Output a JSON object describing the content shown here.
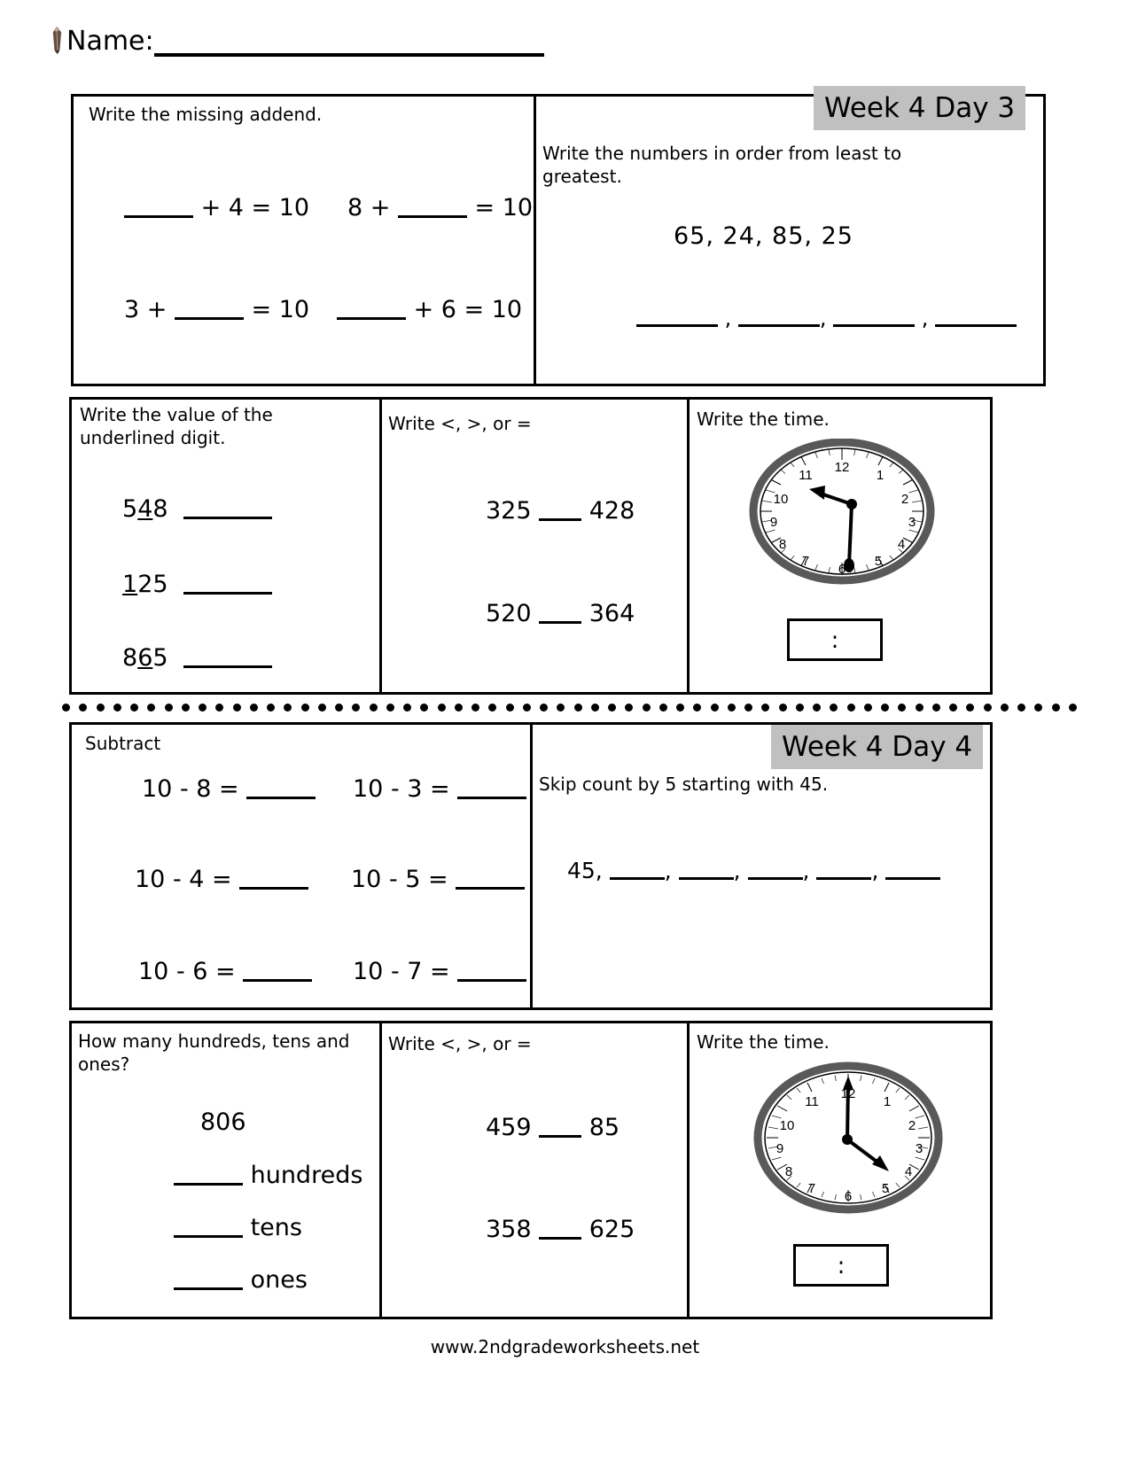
{
  "header": {
    "name_label": "Name:",
    "pencil_icon": "pencil-icon"
  },
  "banners": {
    "day3": "Week 4 Day 3",
    "day4": "Week 4 Day 4"
  },
  "sections": {
    "missing_addend": {
      "prompt": "Write the missing addend.",
      "problems": [
        {
          "text_before": "",
          "blank": true,
          "text_after": "+ 4 = 10"
        },
        {
          "text_before": "8 +",
          "blank": true,
          "text_after": "= 10"
        },
        {
          "text_before": "3 +",
          "blank": true,
          "text_after": "= 10"
        },
        {
          "text_before": "",
          "blank": true,
          "text_after": "+ 6 = 10"
        }
      ],
      "items": [
        "___ + 4 = 10",
        "8 + ___ = 10",
        "3 + ___ = 10",
        "___ + 6 = 10"
      ]
    },
    "order_numbers": {
      "prompt": "Write the numbers in order from least to greatest.",
      "numbers": "65,  24,  85,  25",
      "answer_blanks": 4
    },
    "place_value_underlined": {
      "prompt": "Write the value of the\nunderlined digit.",
      "problems": [
        {
          "pre": "5",
          "underlined": "4",
          "post": "8"
        },
        {
          "pre": "",
          "underlined": "1",
          "post": "25"
        },
        {
          "pre": "8",
          "underlined": "6",
          "post": "5"
        }
      ]
    },
    "compare_top": {
      "prompt": "Write <, >, or =",
      "problems": [
        {
          "left": "325",
          "right": "428"
        },
        {
          "left": "520",
          "right": "364"
        }
      ]
    },
    "clock_top": {
      "prompt": "Write the time.",
      "hour": 10,
      "minute": 30,
      "answer_placeholder": ":",
      "clock_numbers": [
        "12",
        "1",
        "2",
        "3",
        "4",
        "5",
        "6",
        "7",
        "8",
        "9",
        "10",
        "11"
      ]
    },
    "subtract": {
      "prompt": "Subtract",
      "problems": [
        "10 - 8 =",
        "10 - 3 =",
        "10 - 4 =",
        "10 - 5 =",
        "10 - 6 =",
        "10 - 7 ="
      ]
    },
    "skip_count": {
      "prompt": "Skip count by 5 starting with 45.",
      "start": "45,",
      "answer_blanks": 5
    },
    "hundreds_tens_ones": {
      "prompt": "How many hundreds, tens and\nones?",
      "number": "806",
      "labels": [
        "hundreds",
        "tens",
        "ones"
      ]
    },
    "compare_bottom": {
      "prompt": "Write <, >, or =",
      "problems": [
        {
          "left": "459",
          "right": "85"
        },
        {
          "left": "358",
          "right": "625"
        }
      ]
    },
    "clock_bottom": {
      "prompt": "Write the time.",
      "hour": 4,
      "minute": 0,
      "answer_placeholder": ":",
      "clock_numbers": [
        "12",
        "1",
        "2",
        "3",
        "4",
        "5",
        "6",
        "7",
        "8",
        "9",
        "10",
        "11"
      ]
    }
  },
  "footer": {
    "url": "www.2ndgradeworksheets.net"
  },
  "colors": {
    "banner_gray": "#c0c0c0",
    "line_black": "#000000",
    "clock_bezel": "#595959"
  }
}
